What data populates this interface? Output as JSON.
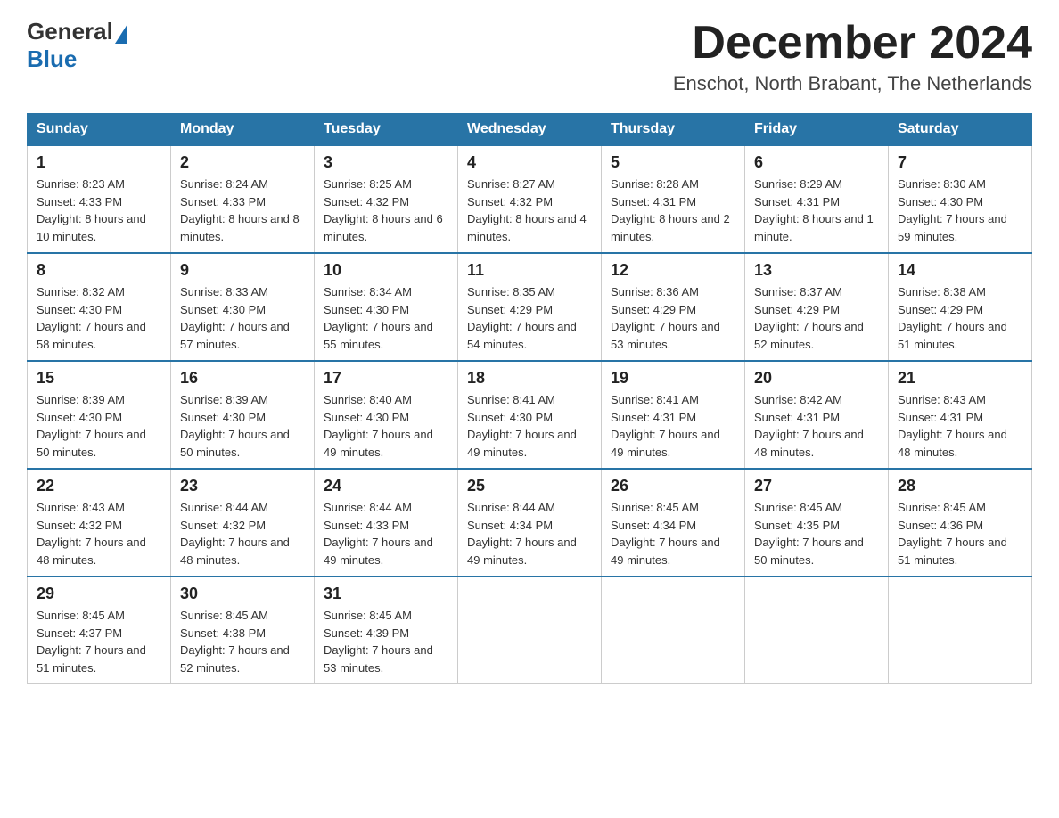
{
  "header": {
    "logo_general": "General",
    "logo_blue": "Blue",
    "title": "December 2024",
    "subtitle": "Enschot, North Brabant, The Netherlands"
  },
  "days_of_week": [
    "Sunday",
    "Monday",
    "Tuesday",
    "Wednesday",
    "Thursday",
    "Friday",
    "Saturday"
  ],
  "weeks": [
    [
      {
        "day": "1",
        "sunrise": "8:23 AM",
        "sunset": "4:33 PM",
        "daylight": "8 hours and 10 minutes."
      },
      {
        "day": "2",
        "sunrise": "8:24 AM",
        "sunset": "4:33 PM",
        "daylight": "8 hours and 8 minutes."
      },
      {
        "day": "3",
        "sunrise": "8:25 AM",
        "sunset": "4:32 PM",
        "daylight": "8 hours and 6 minutes."
      },
      {
        "day": "4",
        "sunrise": "8:27 AM",
        "sunset": "4:32 PM",
        "daylight": "8 hours and 4 minutes."
      },
      {
        "day": "5",
        "sunrise": "8:28 AM",
        "sunset": "4:31 PM",
        "daylight": "8 hours and 2 minutes."
      },
      {
        "day": "6",
        "sunrise": "8:29 AM",
        "sunset": "4:31 PM",
        "daylight": "8 hours and 1 minute."
      },
      {
        "day": "7",
        "sunrise": "8:30 AM",
        "sunset": "4:30 PM",
        "daylight": "7 hours and 59 minutes."
      }
    ],
    [
      {
        "day": "8",
        "sunrise": "8:32 AM",
        "sunset": "4:30 PM",
        "daylight": "7 hours and 58 minutes."
      },
      {
        "day": "9",
        "sunrise": "8:33 AM",
        "sunset": "4:30 PM",
        "daylight": "7 hours and 57 minutes."
      },
      {
        "day": "10",
        "sunrise": "8:34 AM",
        "sunset": "4:30 PM",
        "daylight": "7 hours and 55 minutes."
      },
      {
        "day": "11",
        "sunrise": "8:35 AM",
        "sunset": "4:29 PM",
        "daylight": "7 hours and 54 minutes."
      },
      {
        "day": "12",
        "sunrise": "8:36 AM",
        "sunset": "4:29 PM",
        "daylight": "7 hours and 53 minutes."
      },
      {
        "day": "13",
        "sunrise": "8:37 AM",
        "sunset": "4:29 PM",
        "daylight": "7 hours and 52 minutes."
      },
      {
        "day": "14",
        "sunrise": "8:38 AM",
        "sunset": "4:29 PM",
        "daylight": "7 hours and 51 minutes."
      }
    ],
    [
      {
        "day": "15",
        "sunrise": "8:39 AM",
        "sunset": "4:30 PM",
        "daylight": "7 hours and 50 minutes."
      },
      {
        "day": "16",
        "sunrise": "8:39 AM",
        "sunset": "4:30 PM",
        "daylight": "7 hours and 50 minutes."
      },
      {
        "day": "17",
        "sunrise": "8:40 AM",
        "sunset": "4:30 PM",
        "daylight": "7 hours and 49 minutes."
      },
      {
        "day": "18",
        "sunrise": "8:41 AM",
        "sunset": "4:30 PM",
        "daylight": "7 hours and 49 minutes."
      },
      {
        "day": "19",
        "sunrise": "8:41 AM",
        "sunset": "4:31 PM",
        "daylight": "7 hours and 49 minutes."
      },
      {
        "day": "20",
        "sunrise": "8:42 AM",
        "sunset": "4:31 PM",
        "daylight": "7 hours and 48 minutes."
      },
      {
        "day": "21",
        "sunrise": "8:43 AM",
        "sunset": "4:31 PM",
        "daylight": "7 hours and 48 minutes."
      }
    ],
    [
      {
        "day": "22",
        "sunrise": "8:43 AM",
        "sunset": "4:32 PM",
        "daylight": "7 hours and 48 minutes."
      },
      {
        "day": "23",
        "sunrise": "8:44 AM",
        "sunset": "4:32 PM",
        "daylight": "7 hours and 48 minutes."
      },
      {
        "day": "24",
        "sunrise": "8:44 AM",
        "sunset": "4:33 PM",
        "daylight": "7 hours and 49 minutes."
      },
      {
        "day": "25",
        "sunrise": "8:44 AM",
        "sunset": "4:34 PM",
        "daylight": "7 hours and 49 minutes."
      },
      {
        "day": "26",
        "sunrise": "8:45 AM",
        "sunset": "4:34 PM",
        "daylight": "7 hours and 49 minutes."
      },
      {
        "day": "27",
        "sunrise": "8:45 AM",
        "sunset": "4:35 PM",
        "daylight": "7 hours and 50 minutes."
      },
      {
        "day": "28",
        "sunrise": "8:45 AM",
        "sunset": "4:36 PM",
        "daylight": "7 hours and 51 minutes."
      }
    ],
    [
      {
        "day": "29",
        "sunrise": "8:45 AM",
        "sunset": "4:37 PM",
        "daylight": "7 hours and 51 minutes."
      },
      {
        "day": "30",
        "sunrise": "8:45 AM",
        "sunset": "4:38 PM",
        "daylight": "7 hours and 52 minutes."
      },
      {
        "day": "31",
        "sunrise": "8:45 AM",
        "sunset": "4:39 PM",
        "daylight": "7 hours and 53 minutes."
      },
      null,
      null,
      null,
      null
    ]
  ]
}
